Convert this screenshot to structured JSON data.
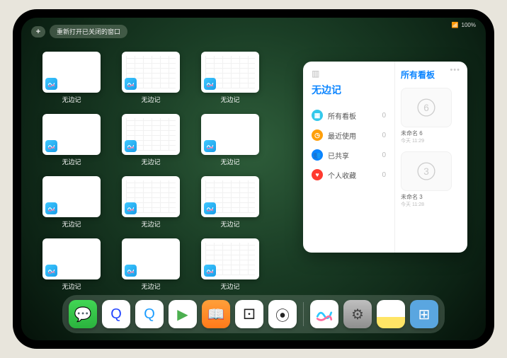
{
  "status": {
    "signal": "📶",
    "battery": "100%"
  },
  "topbar": {
    "plus": "+",
    "reopen_label": "重新打开已关闭的窗口"
  },
  "thumbs": [
    {
      "label": "无边记",
      "content": false
    },
    {
      "label": "无边记",
      "content": true
    },
    {
      "label": "无边记",
      "content": true
    },
    {
      "label": "无边记",
      "content": false
    },
    {
      "label": "无边记",
      "content": true
    },
    {
      "label": "无边记",
      "content": false
    },
    {
      "label": "无边记",
      "content": false
    },
    {
      "label": "无边记",
      "content": true
    },
    {
      "label": "无边记",
      "content": true
    },
    {
      "label": "无边记",
      "content": false
    },
    {
      "label": "无边记",
      "content": false
    },
    {
      "label": "无边记",
      "content": true
    }
  ],
  "panel": {
    "title": "无边记",
    "right_title": "所有看板",
    "categories": [
      {
        "icon": "▦",
        "color": "#34c8eb",
        "label": "所有看板",
        "count": 0
      },
      {
        "icon": "◷",
        "color": "#ff9f0a",
        "label": "最近使用",
        "count": 0
      },
      {
        "icon": "👥",
        "color": "#0a84ff",
        "label": "已共享",
        "count": 0
      },
      {
        "icon": "♥",
        "color": "#ff3b30",
        "label": "个人收藏",
        "count": 0
      }
    ],
    "boards": [
      {
        "name": "未命名 6",
        "sub": "今天 11:29",
        "digit": "6"
      },
      {
        "name": "未命名 3",
        "sub": "今天 11:28",
        "digit": "3"
      }
    ]
  },
  "dock": {
    "items": [
      {
        "name": "wechat",
        "bg": "linear-gradient(180deg,#41d654,#2bb33e)",
        "glyph": "💬"
      },
      {
        "name": "quark-hd",
        "bg": "#fff",
        "glyph": "Q",
        "glyphColor": "#2244ff"
      },
      {
        "name": "quark",
        "bg": "#fff",
        "glyph": "Q",
        "glyphColor": "#1a9cff"
      },
      {
        "name": "play",
        "bg": "#fff",
        "glyph": "▶",
        "glyphColor": "#4caf50"
      },
      {
        "name": "books",
        "bg": "linear-gradient(180deg,#ff9f3a,#ff7a1a)",
        "glyph": "📖"
      },
      {
        "name": "dice",
        "bg": "#fff",
        "glyph": "⚀",
        "glyphColor": "#222"
      },
      {
        "name": "nodes",
        "bg": "#fff",
        "glyph": "⦿",
        "glyphColor": "#222"
      }
    ],
    "system": [
      {
        "name": "freeform",
        "bg": "#fff",
        "glyph": "〰",
        "glyphColor": "#2dc8ff"
      },
      {
        "name": "settings",
        "bg": "linear-gradient(180deg,#bfbfbf,#8e8e8e)",
        "glyph": "⚙",
        "glyphColor": "#444"
      },
      {
        "name": "notes",
        "bg": "linear-gradient(180deg,#fff 60%,#ffe566 60%)",
        "glyph": "",
        "glyphColor": "#999"
      },
      {
        "name": "app-library",
        "bg": "#5aa6e0",
        "glyph": "⊞",
        "glyphColor": "#fff"
      }
    ]
  }
}
